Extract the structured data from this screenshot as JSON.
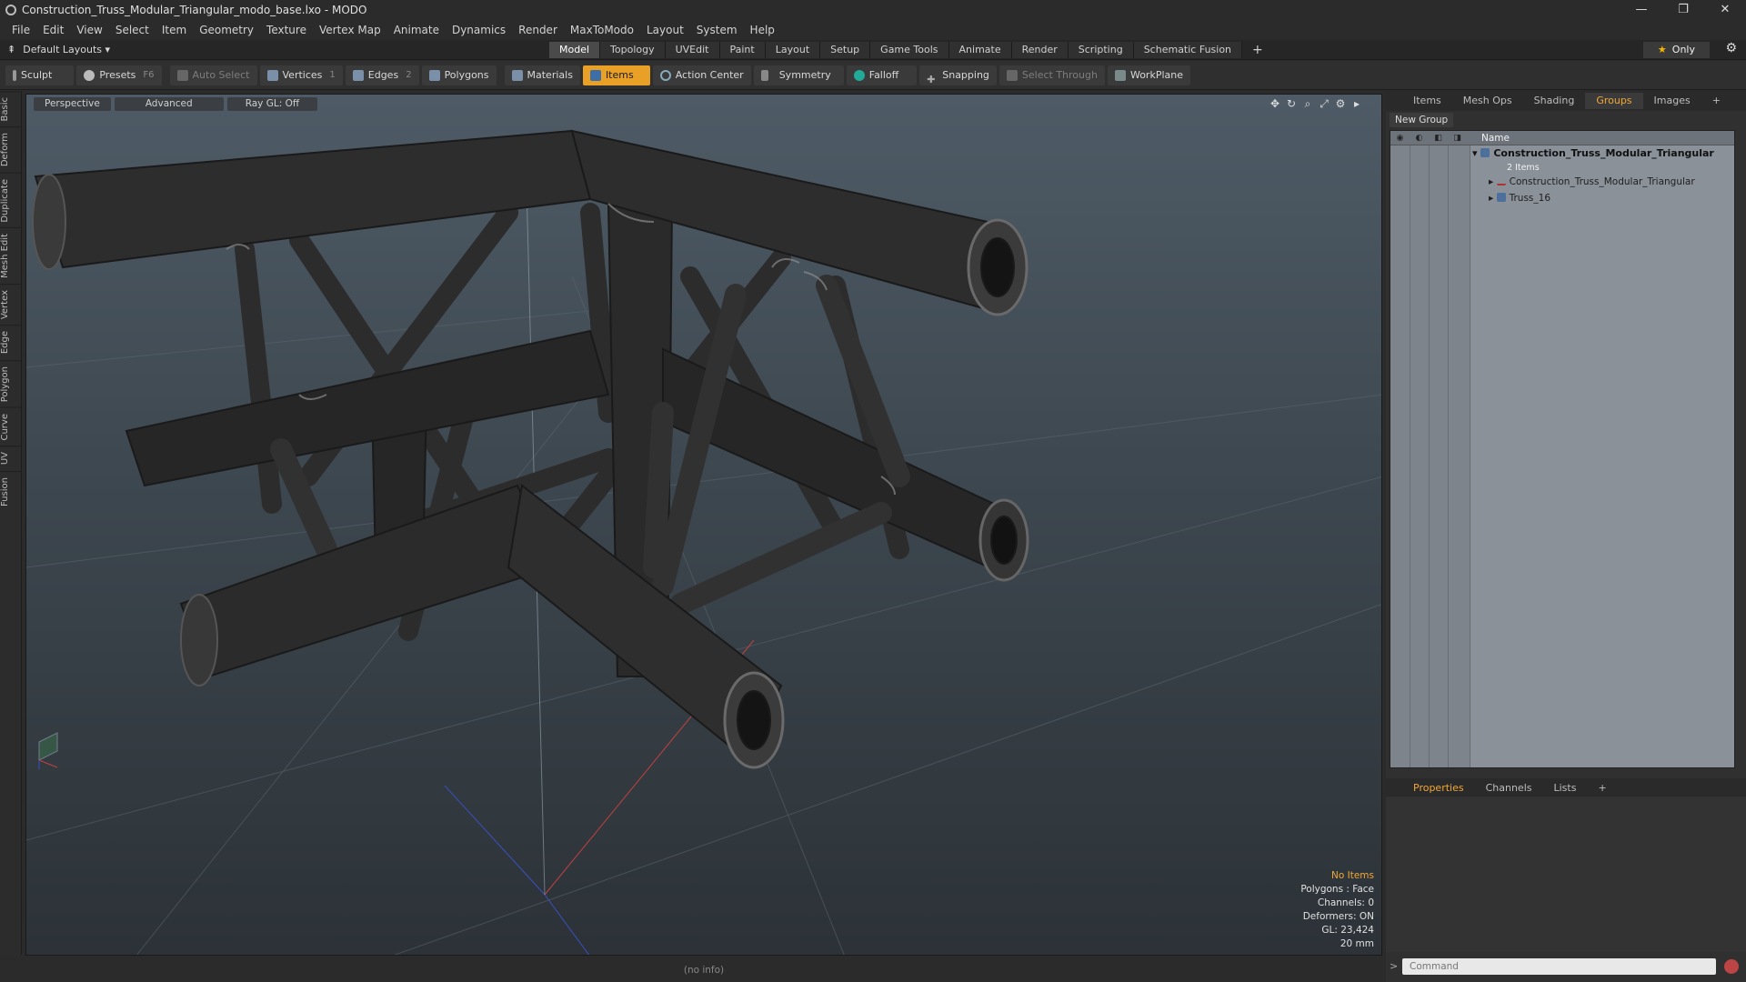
{
  "window": {
    "title": "Construction_Truss_Modular_Triangular_modo_base.lxo - MODO",
    "controls": [
      "—",
      "❐",
      "✕"
    ]
  },
  "menu": [
    "File",
    "Edit",
    "View",
    "Select",
    "Item",
    "Geometry",
    "Texture",
    "Vertex Map",
    "Animate",
    "Dynamics",
    "Render",
    "MaxToModo",
    "Layout",
    "System",
    "Help"
  ],
  "layoutbar": {
    "layout_name": "Default Layouts ▾",
    "tabs": [
      "Model",
      "Topology",
      "UVEdit",
      "Paint",
      "Layout",
      "Setup",
      "Game Tools",
      "Animate",
      "Render",
      "Scripting",
      "Schematic Fusion"
    ],
    "active_tab": "Model",
    "add": "+",
    "only_label": "Only"
  },
  "toolbar": {
    "sculpt": "Sculpt",
    "presets": "Presets",
    "presets_key": "F6",
    "auto_select": "Auto Select",
    "vertices": "Vertices",
    "vertices_num": "1",
    "edges": "Edges",
    "edges_num": "2",
    "polygons": "Polygons",
    "materials": "Materials",
    "items": "Items",
    "action_center": "Action Center",
    "symmetry": "Symmetry",
    "falloff": "Falloff",
    "snapping": "Snapping",
    "select_through": "Select Through",
    "workplane": "WorkPlane"
  },
  "left_tabs": [
    "Basic",
    "Deform",
    "Duplicate",
    "Mesh Edit",
    "Vertex",
    "Edge",
    "Polygon",
    "Curve",
    "UV",
    "Fusion"
  ],
  "viewport": {
    "view": "Perspective",
    "mode": "Advanced",
    "raygl": "Ray GL: Off",
    "info": {
      "selection": "No Items",
      "polygons": "Polygons : Face",
      "channels": "Channels: 0",
      "deformers": "Deformers: ON",
      "gl": "GL: 23,424",
      "size": "20 mm"
    }
  },
  "status": "(no info)",
  "right_panel": {
    "tabs": [
      "Items",
      "Mesh Ops",
      "Shading",
      "Groups",
      "Images"
    ],
    "active_tab": "Groups",
    "new_group": "New Group",
    "column_name": "Name",
    "group_name": "Construction_Truss_Modular_Triangular",
    "group_count": "2 Items",
    "children": [
      "Construction_Truss_Modular_Triangular",
      "Truss_16"
    ]
  },
  "properties": {
    "tabs": [
      "Properties",
      "Channels",
      "Lists"
    ],
    "active_tab": "Properties",
    "command_placeholder": "Command"
  },
  "colors": {
    "accent": "#f0a838",
    "viewport_top": "#4e5b66",
    "viewport_bottom": "#2c3237",
    "truss": "#2a2a2a"
  }
}
